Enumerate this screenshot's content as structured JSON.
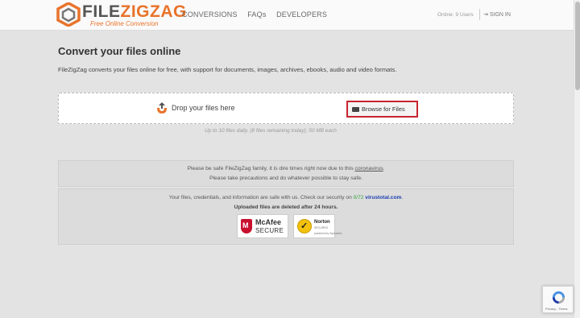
{
  "header": {
    "logo_part1": "FILE",
    "logo_part2": "ZIGZAG",
    "logo_subtitle": "Free Online Conversion",
    "nav": [
      "CONVERSIONS",
      "FAQs",
      "DEVELOPERS"
    ],
    "online_status": "Online: 9 Users",
    "signin_label": "SIGN IN"
  },
  "main": {
    "title": "Convert your files online",
    "description": "FileZigZag converts your files online for free, with support for documents, images, archives, ebooks, audio and video formats.",
    "drop_label": "Drop your files here",
    "browse_label": "Browse for Files",
    "limit_note": "Up to 10 files daily. (8 files remaining today); 50 MB each"
  },
  "notice": {
    "line1_prefix": "Please be safe FileZigZag family, it is dire times right now due to this ",
    "line1_link": "coronavirus",
    "line1_suffix": ".",
    "line2": "Please take precautions and do whatever possible to stay safe."
  },
  "security": {
    "line1_prefix": "Your files, credentials, and information are safe with us. Check our security on ",
    "score": "0/72",
    "site": "virustotal.com",
    "line1_suffix": ".",
    "line2": "Uploaded files are deleted after 24 hours.",
    "mcafee_name": "McAfee",
    "mcafee_tag": "SECURE",
    "norton_name": "Norton",
    "norton_line2": "SECURED",
    "norton_line3": "powered by Symantec"
  },
  "recaptcha": {
    "terms": "Privacy - Terms"
  },
  "colors": {
    "brand_orange": "#e8732a",
    "browse_border": "#c8242f",
    "score_green": "#2e9e3e",
    "link_blue": "#1d3fb0"
  },
  "icons": [
    "logo-mark-icon",
    "upload-drop-icon",
    "folder-icon",
    "signin-icon",
    "mcafee-shield-icon",
    "norton-check-icon",
    "recaptcha-icon"
  ]
}
